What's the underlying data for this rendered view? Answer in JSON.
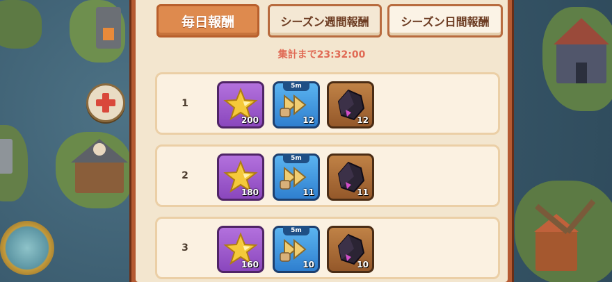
{
  "tabs": [
    {
      "label": "毎日報酬",
      "active": true
    },
    {
      "label": "シーズン週間報酬",
      "active": false
    },
    {
      "label": "シーズン日間報酬",
      "active": false
    }
  ],
  "timer": "集計まで23:32:00",
  "rows": [
    {
      "rank": "1",
      "rewards": [
        {
          "type": "star-icon",
          "qty": "200"
        },
        {
          "type": "speedup-icon",
          "badge": "5m",
          "qty": "12"
        },
        {
          "type": "dark-crystal-icon",
          "qty": "12"
        }
      ]
    },
    {
      "rank": "2",
      "rewards": [
        {
          "type": "star-icon",
          "qty": "180"
        },
        {
          "type": "speedup-icon",
          "badge": "5m",
          "qty": "11"
        },
        {
          "type": "dark-crystal-icon",
          "qty": "11"
        }
      ]
    },
    {
      "rank": "3",
      "rewards": [
        {
          "type": "star-icon",
          "qty": "160"
        },
        {
          "type": "speedup-icon",
          "badge": "5m",
          "qty": "10"
        },
        {
          "type": "dark-crystal-icon",
          "qty": "10"
        }
      ]
    }
  ],
  "colors": {
    "accent": "#de8a4e",
    "timer": "#e06a55",
    "panel_border": "#b45a32"
  }
}
